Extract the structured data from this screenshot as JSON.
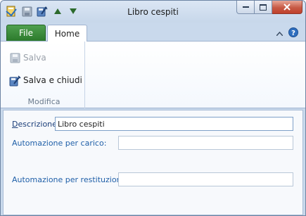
{
  "window": {
    "title": "Libro cespiti"
  },
  "tabs": {
    "file": "File",
    "home": "Home"
  },
  "ribbon": {
    "save_label": "Salva",
    "save_close_label": "Salva e chiudi",
    "group_label": "Modifica"
  },
  "form": {
    "descrizione": {
      "label_u": "D",
      "label_rest": "escrizione:",
      "value": "Libro cespiti"
    },
    "automazione_carico": {
      "label": "Automazione per carico:",
      "value": ""
    },
    "automazione_restituzione": {
      "label": "Automazione per restituzione:",
      "value": ""
    }
  },
  "colors": {
    "file_tab": "#2c7a2c",
    "label_text": "#1f5fa8",
    "frame": "#c9d9ec",
    "close_button": "#c75a45"
  },
  "icons": {
    "qat": [
      "app-book-icon",
      "save-icon",
      "save-close-icon",
      "arrow-up-icon",
      "arrow-down-icon"
    ],
    "window": [
      "minimize-icon",
      "maximize-icon",
      "close-icon"
    ],
    "ribbon": [
      "collapse-ribbon-icon",
      "help-icon"
    ]
  }
}
